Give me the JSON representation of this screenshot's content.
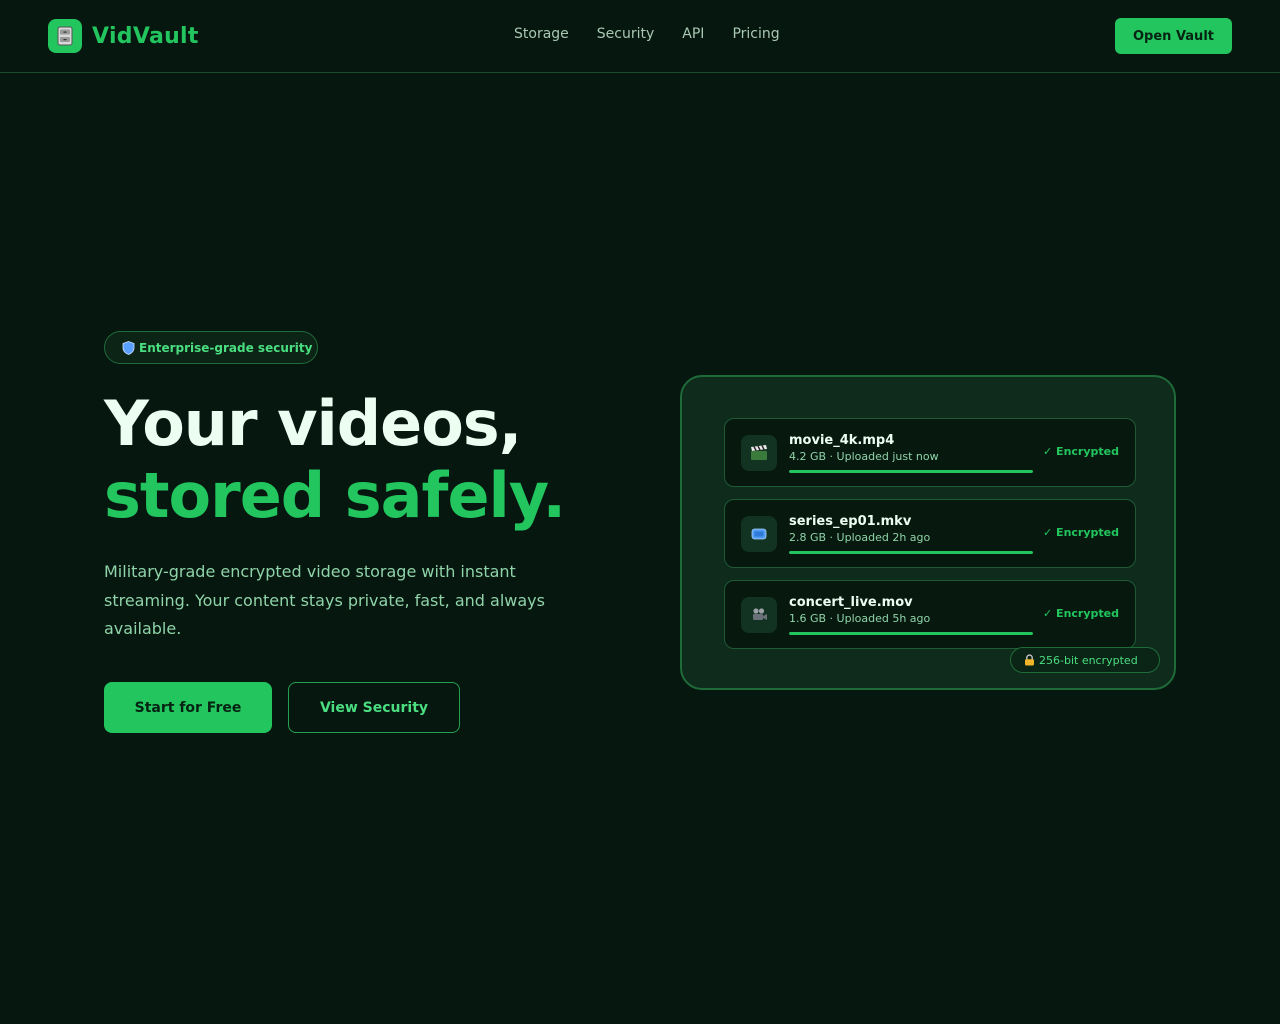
{
  "nav": {
    "brand": "VidVault",
    "links": [
      "Storage",
      "Security",
      "API",
      "Pricing"
    ],
    "cta": "Open Vault"
  },
  "hero": {
    "badge": "Enterprise-grade security",
    "headline_line1": "Your videos,",
    "headline_line2": "stored safely.",
    "subtitle": "Military-grade encrypted video storage with instant streaming. Your content stays private, fast, and always available.",
    "primary_cta": "Start for Free",
    "secondary_cta": "View Security"
  },
  "vault": {
    "files": [
      {
        "name": "movie_4k.mp4",
        "meta": "4.2 GB · Uploaded just now",
        "status": "✓ Encrypted",
        "progress": 1.0,
        "icon": "clapperboard-icon"
      },
      {
        "name": "series_ep01.mkv",
        "meta": "2.8 GB · Uploaded 2h ago",
        "status": "✓ Encrypted",
        "progress": 1.0,
        "icon": "tv-icon"
      },
      {
        "name": "concert_live.mov",
        "meta": "1.6 GB · Uploaded 5h ago",
        "status": "✓ Encrypted",
        "progress": 1.0,
        "icon": "video-camera-icon"
      }
    ],
    "encryption_badge": "256-bit encrypted"
  },
  "colors": {
    "accent": "#22c55e",
    "background": "#061710",
    "panel": "#0e2b1b"
  }
}
